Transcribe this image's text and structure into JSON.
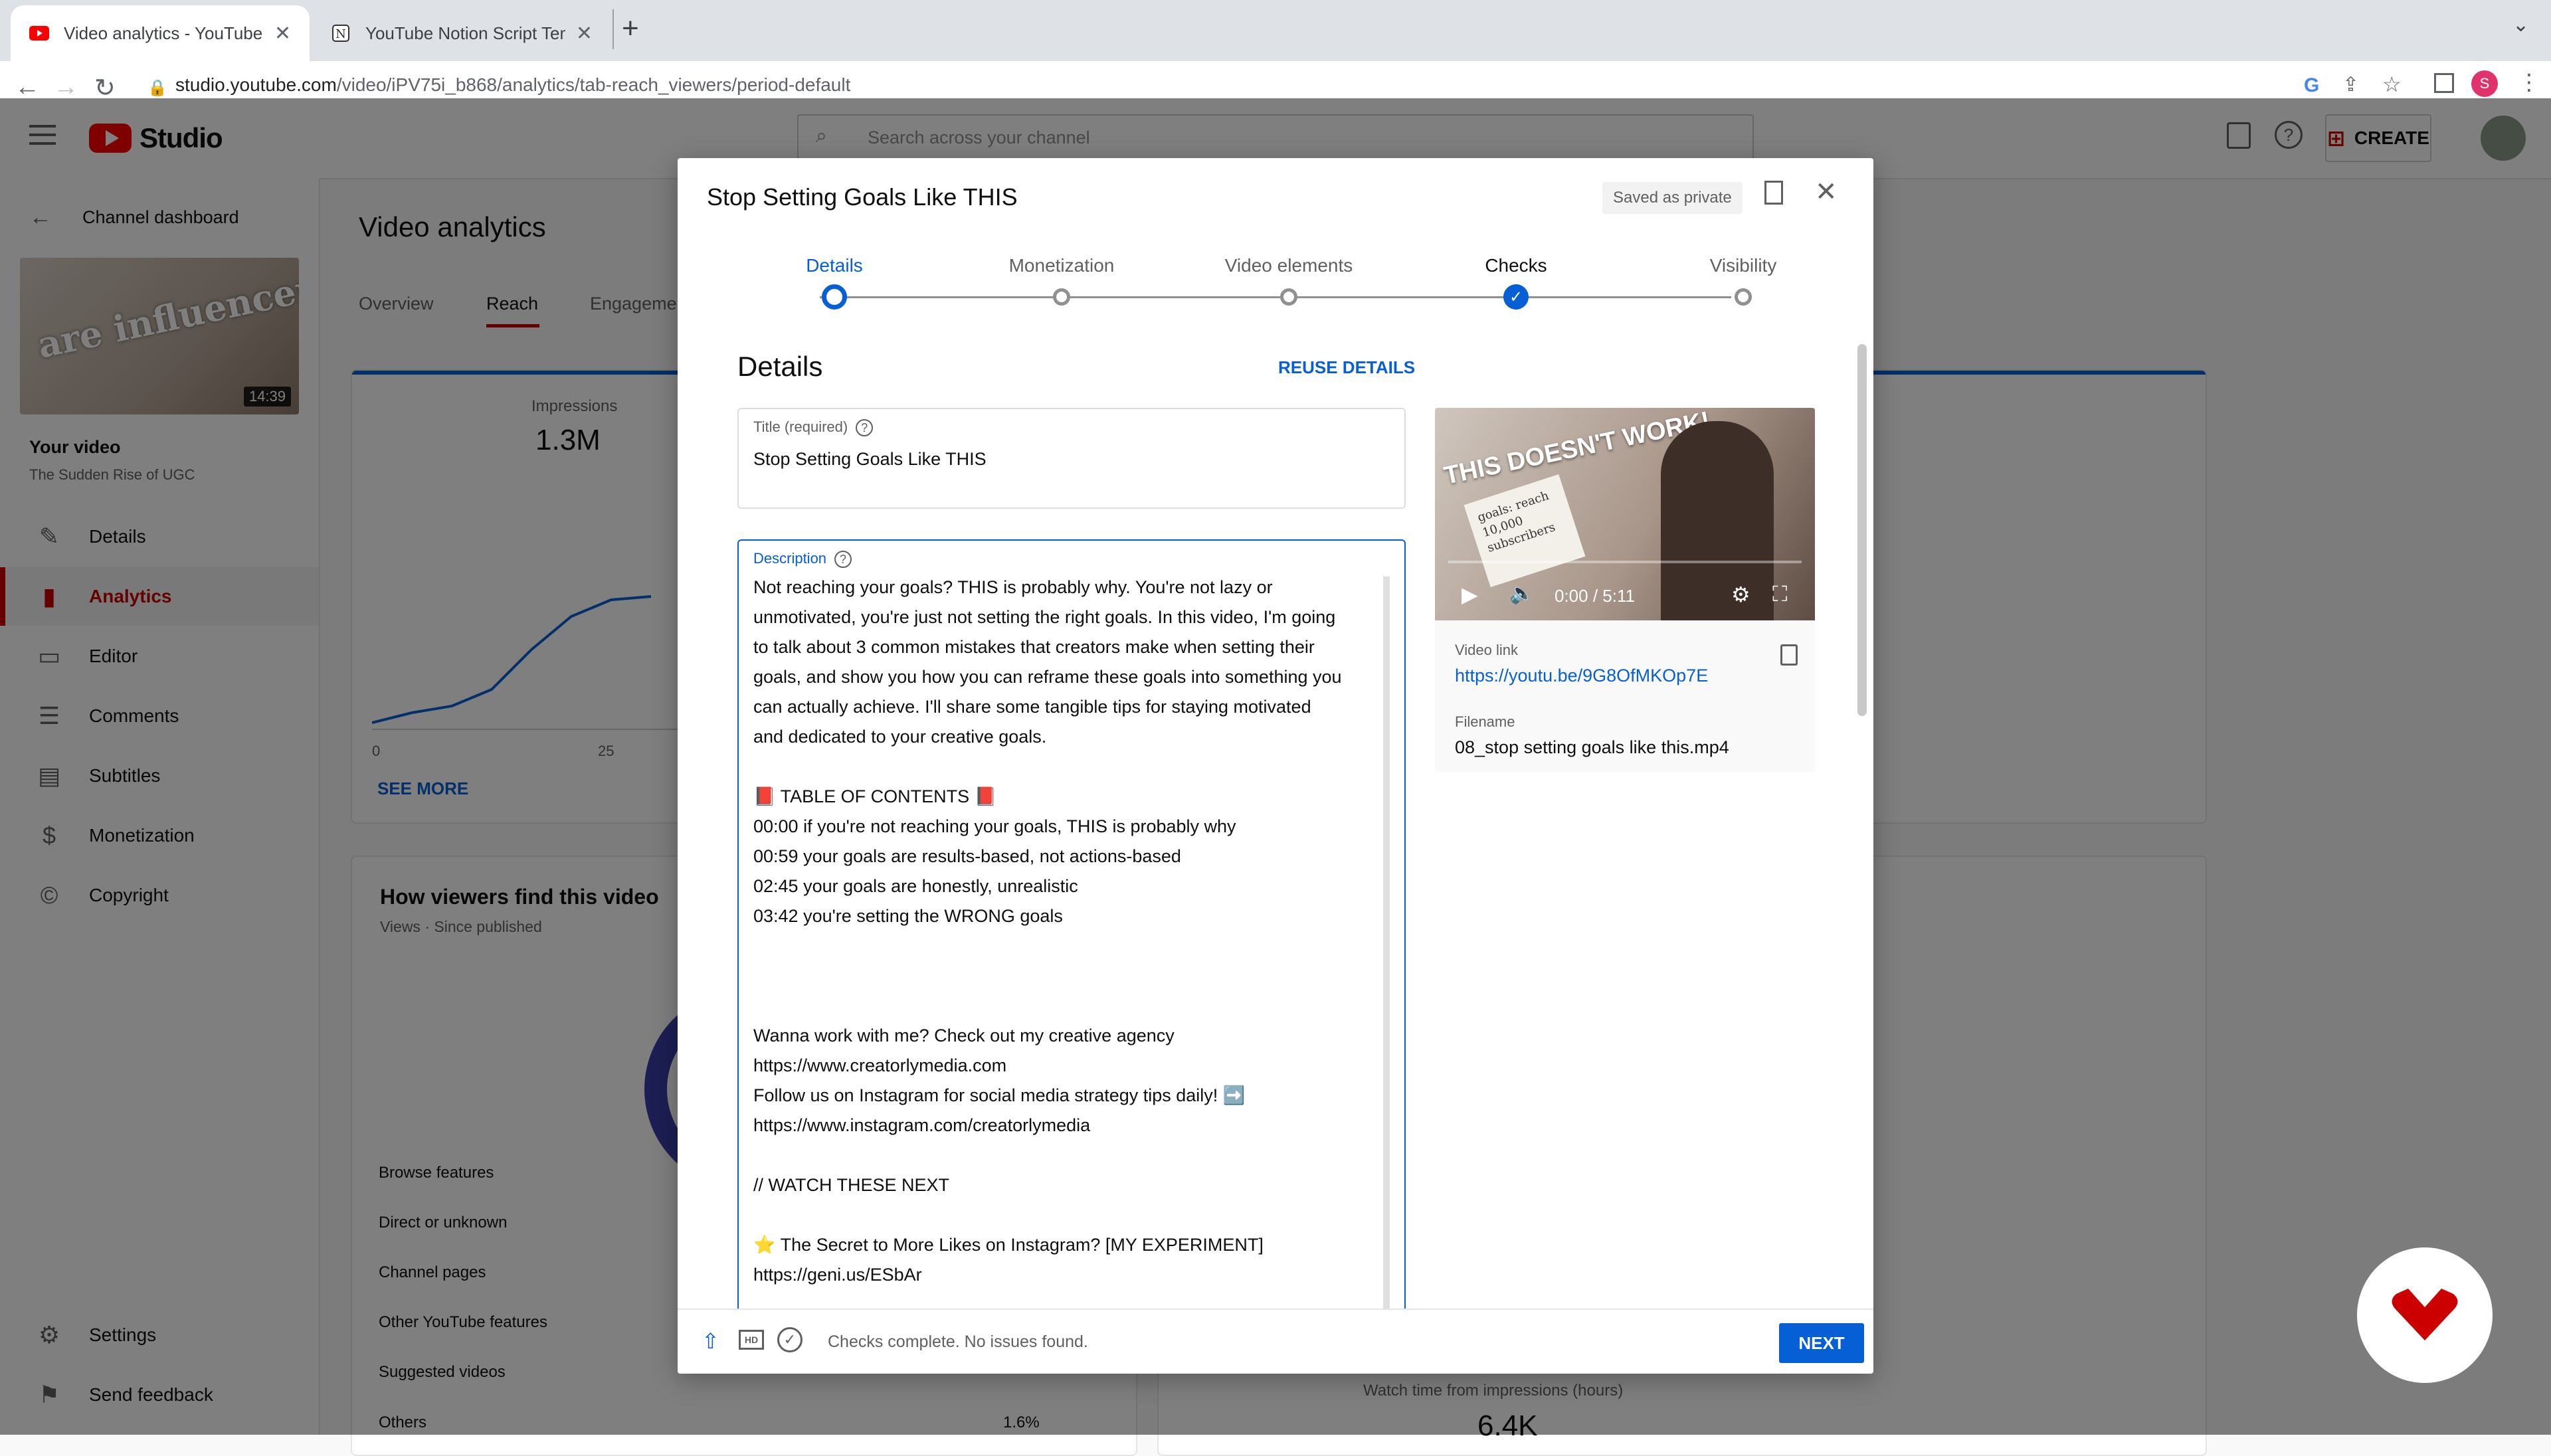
{
  "browser": {
    "tabs": [
      {
        "title": "Video analytics - YouTube Studio"
      },
      {
        "title": "YouTube Notion Script Template"
      }
    ],
    "url_host": "studio.youtube.com",
    "url_path": "/video/iPV75i_b868/analytics/tab-reach_viewers/period-default",
    "profile_initial": "S"
  },
  "header": {
    "logo_text": "Studio",
    "search_placeholder": "Search across your channel",
    "create_label": "CREATE"
  },
  "sidebar": {
    "back_label": "Channel dashboard",
    "thumb_duration": "14:39",
    "thumb_caption": "are influencers OVER?",
    "your_video": "Your video",
    "video_name": "The Sudden Rise of UGC",
    "items": [
      {
        "label": "Details",
        "icon": "pencil-icon"
      },
      {
        "label": "Analytics",
        "icon": "analytics-icon"
      },
      {
        "label": "Editor",
        "icon": "editor-icon"
      },
      {
        "label": "Comments",
        "icon": "comments-icon"
      },
      {
        "label": "Subtitles",
        "icon": "subtitles-icon"
      },
      {
        "label": "Monetization",
        "icon": "dollar-icon"
      },
      {
        "label": "Copyright",
        "icon": "copyright-icon"
      }
    ],
    "settings_label": "Settings",
    "feedback_label": "Send feedback"
  },
  "main": {
    "title": "Video analytics",
    "tabs": [
      "Overview",
      "Reach",
      "Engagement"
    ],
    "impressions_label": "Impressions",
    "impressions_value": "1.3M",
    "axis_ticks": [
      "0",
      "25"
    ],
    "see_more": "SEE MORE",
    "viewers_title": "How viewers find this video",
    "viewers_sub": "Views · Since published",
    "sources": [
      "Browse features",
      "Direct or unknown",
      "Channel pages",
      "Other YouTube features",
      "Suggested videos",
      "Others"
    ],
    "others_pct": "1.6%",
    "watch_time_label": "Watch time from impressions (hours)",
    "watch_time_value": "6.4K"
  },
  "dialog": {
    "title": "Stop Setting Goals Like THIS",
    "saved_badge": "Saved as private",
    "steps": [
      "Details",
      "Monetization",
      "Video elements",
      "Checks",
      "Visibility"
    ],
    "section_title": "Details",
    "reuse_label": "REUSE DETAILS",
    "title_label": "Title (required)",
    "title_value": "Stop Setting Goals Like THIS",
    "desc_label": "Description",
    "description_lines": [
      "Not reaching your goals? THIS is probably why. You're not lazy or",
      "unmotivated, you're just not setting the right goals. In this video, I'm going",
      "to talk about 3 common mistakes that creators make when setting their",
      "goals, and show you how you can reframe these goals into something you",
      "can actually achieve. I'll share some tangible tips for staying motivated",
      "and dedicated to your creative goals.",
      "",
      "📕 TABLE OF CONTENTS 📕",
      "00:00 if you're not reaching your goals, THIS is probably why",
      "00:59 your goals are results-based, not actions-based",
      "02:45 your goals are honestly, unrealistic",
      "03:42 you're setting the WRONG goals",
      "",
      "",
      "",
      "Wanna work with me? Check out my creative agency",
      "https://www.creatorlymedia.com",
      "Follow us on Instagram for social media strategy tips daily! ➡️",
      "https://www.instagram.com/creatorlymedia",
      "",
      "// WATCH THESE NEXT",
      "",
      "⭐ The Secret to More Likes on Instagram? [MY EXPERIMENT]",
      "https://geni.us/ESbAr"
    ],
    "preview": {
      "thumb_text": "THIS DOESN'T WORK!",
      "notebook_text": "goals: reach 10,000 subscribers",
      "time": "0:00 / 5:11",
      "video_link_label": "Video link",
      "video_link": "https://youtu.be/9G8OfMKOp7E",
      "filename_label": "Filename",
      "filename": "08_stop setting goals like this.mp4"
    },
    "footer_status": "Checks complete. No issues found.",
    "next_label": "NEXT"
  },
  "colors": {
    "accent": "#065fd4",
    "brand_red": "#ff0000",
    "corner_badge": "#cc0000"
  }
}
